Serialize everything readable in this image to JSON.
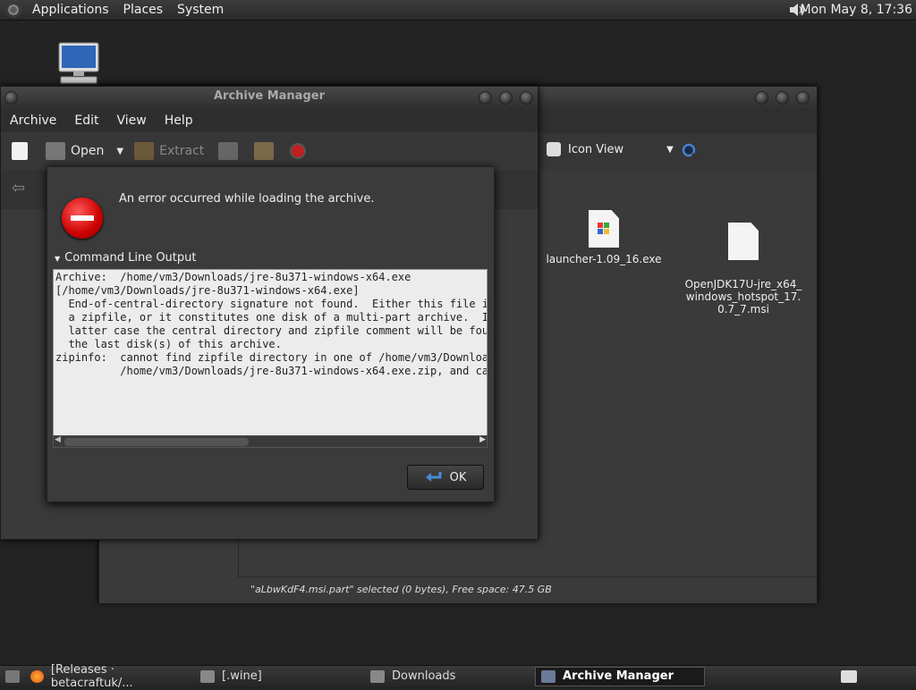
{
  "top_panel": {
    "menus": [
      "Applications",
      "Places",
      "System"
    ],
    "clock": "Mon May  8, 17:36"
  },
  "file_manager": {
    "view_label": "Icon View",
    "files": [
      {
        "name": "launcher-1.09_16.exe",
        "icon": "exe-icon"
      },
      {
        "name": "OpenJDK17U-jre_x64_\nwindows_hotspot_17.\n0.7_7.msi",
        "icon": "file-icon"
      }
    ],
    "status": "\"aLbwKdF4.msi.part\" selected (0 bytes), Free space: 47.5 GB"
  },
  "archive_manager": {
    "title": "Archive Manager",
    "menus": [
      "Archive",
      "Edit",
      "View",
      "Help"
    ],
    "toolbar": {
      "open": "Open",
      "extract": "Extract"
    }
  },
  "dialog": {
    "message": "An error occurred while loading the archive.",
    "expander": "Command Line Output",
    "output": "Archive:  /home/vm3/Downloads/jre-8u371-windows-x64.exe\n[/home/vm3/Downloads/jre-8u371-windows-x64.exe]\n  End-of-central-directory signature not found.  Either this file is not\n  a zipfile, or it constitutes one disk of a multi-part archive.  In the\n  latter case the central directory and zipfile comment will be found on\n  the last disk(s) of this archive.\nzipinfo:  cannot find zipfile directory in one of /home/vm3/Downloads/jre-8u371-windows-x64.exe or\n          /home/vm3/Downloads/jre-8u371-windows-x64.exe.zip, and cannot find",
    "ok": "OK"
  },
  "taskbar": {
    "tasks": [
      "[Releases · betacraftuk/...",
      "[.wine]",
      "Downloads",
      "Archive Manager"
    ]
  },
  "colors": {
    "error": "#cc0000",
    "panel": "#2e2e2e"
  }
}
